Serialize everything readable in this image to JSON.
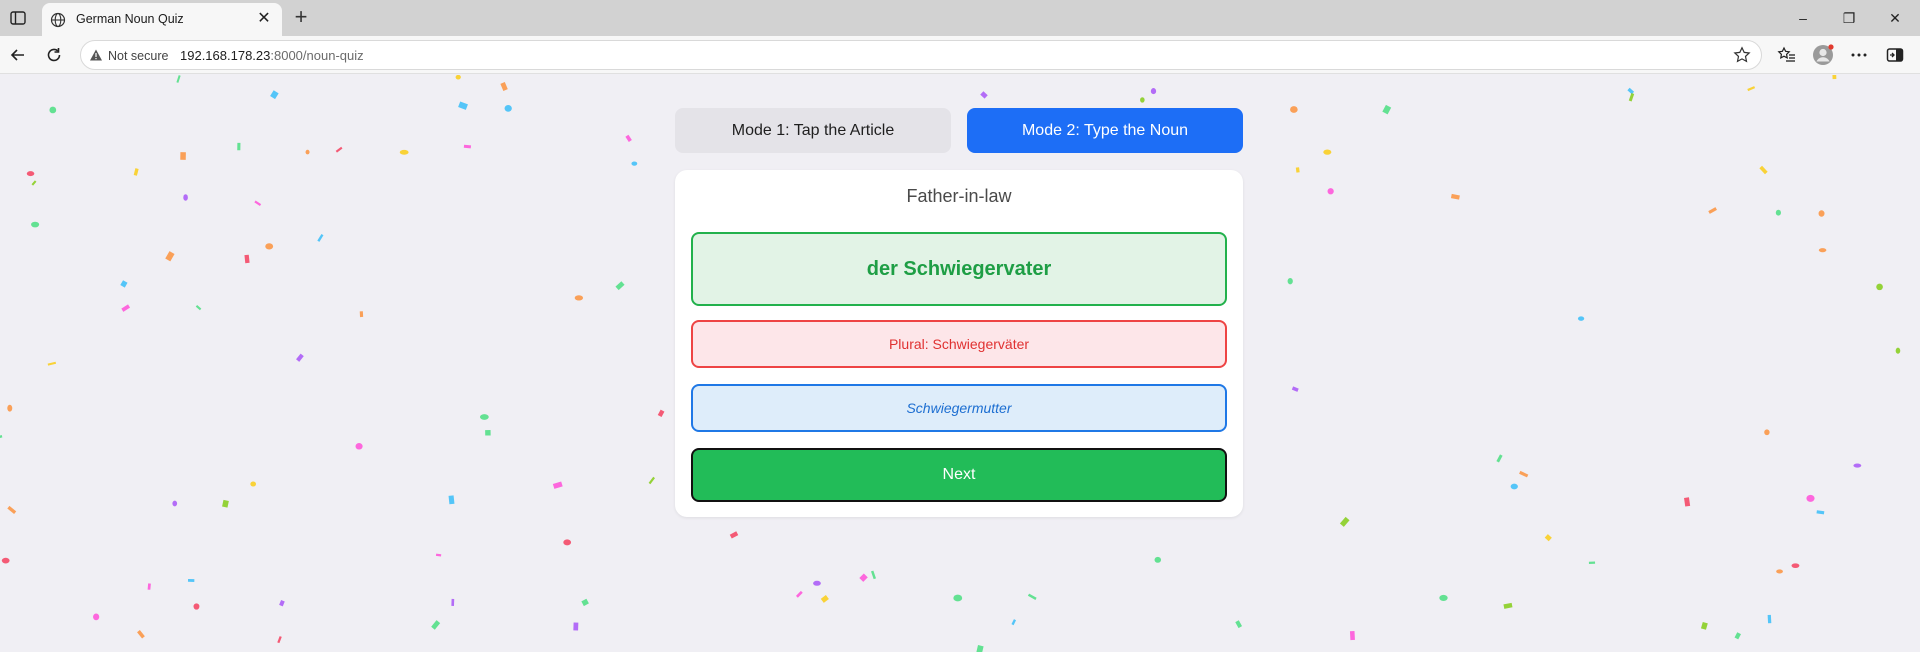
{
  "browser": {
    "tab_title": "German Noun Quiz",
    "tab_close": "✕",
    "new_tab": "+",
    "security_label": "Not secure",
    "url_host": "192.168.178.23",
    "url_rest": ":8000/noun-quiz",
    "window_controls": {
      "minimize": "–",
      "restore": "❐",
      "close": "✕"
    }
  },
  "modes": {
    "mode1_label": "Mode 1: Tap the Article",
    "mode2_label": "Mode 2: Type the Noun",
    "active": "mode2"
  },
  "quiz": {
    "prompt": "Father-in-law",
    "answer": "der Schwiegervater",
    "plural": "Plural: Schwiegerväter",
    "related": "Schwiegermutter",
    "next_label": "Next"
  },
  "colors": {
    "accent_blue": "#1d6ef6",
    "correct_green": "#22b14c",
    "plural_red": "#ee4444",
    "related_blue": "#1f78e6",
    "next_green": "#22bc58"
  },
  "icons": [
    "tab-actions-icon",
    "globe-icon",
    "back-icon",
    "reload-icon",
    "warning-icon",
    "star-icon",
    "favorites-icon",
    "profile-icon",
    "more-icon",
    "sidebar-icon"
  ]
}
